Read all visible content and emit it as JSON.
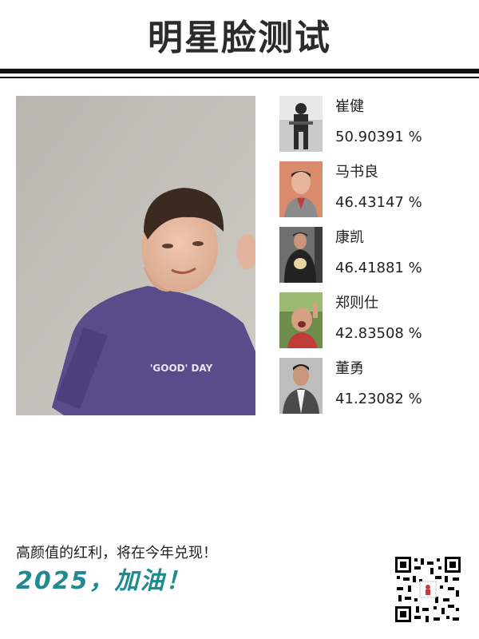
{
  "header": {
    "title": "明星脸测试"
  },
  "main_photo": {
    "icon": "person-photo",
    "shirt_text": "'GOOD' DAY"
  },
  "results": [
    {
      "name": "崔健",
      "score": "50.90391 %",
      "icon": "celebrity-thumb"
    },
    {
      "name": "马书良",
      "score": "46.43147 %",
      "icon": "celebrity-thumb"
    },
    {
      "name": "康凯",
      "score": "46.41881 %",
      "icon": "celebrity-thumb"
    },
    {
      "name": "郑则仕",
      "score": "42.83508 %",
      "icon": "celebrity-thumb"
    },
    {
      "name": "董勇",
      "score": "41.23082 %",
      "icon": "celebrity-thumb"
    }
  ],
  "footer": {
    "slogan_line1": "高颜值的红利，将在今年兑现！",
    "slogan_line2": "2025，加油！",
    "accent_color": "#1f8a8f",
    "qr_icon": "qr-code"
  }
}
